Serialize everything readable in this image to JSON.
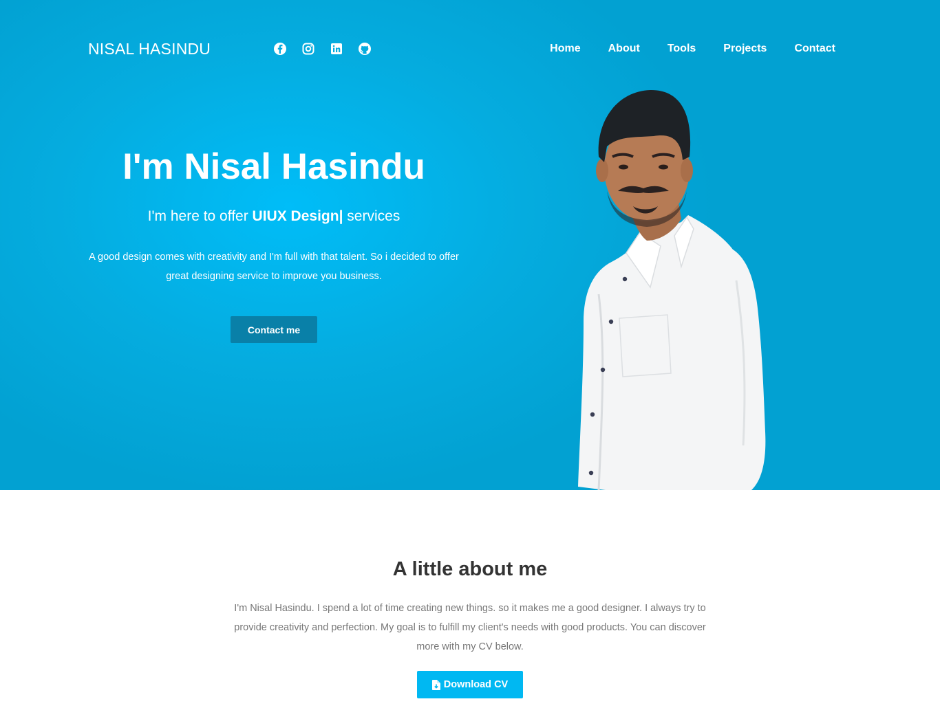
{
  "header": {
    "brand": "NISAL HASINDU",
    "socials": [
      {
        "icon": "facebook-icon"
      },
      {
        "icon": "instagram-icon"
      },
      {
        "icon": "linkedin-icon"
      },
      {
        "icon": "github-icon"
      }
    ],
    "nav": [
      "Home",
      "About",
      "Tools",
      "Projects",
      "Contact"
    ]
  },
  "hero": {
    "title": "I'm Nisal Hasindu",
    "subtitle_prefix": "I'm here to offer",
    "subtitle_highlight": "UIUX Design|",
    "subtitle_suffix": "services",
    "description": "A good design comes with creativity and I'm full with that talent. So i decided to offer great designing service to improve you business.",
    "cta_label": "Contact me"
  },
  "about": {
    "title": "A little about me",
    "text": "I'm Nisal Hasindu. I spend a lot of time creating new things. so it makes me a good designer. I always try to provide creativity and perfection. My goal is to fulfill my client's needs with good products. You can discover more with my CV below.",
    "cv_label": "Download CV"
  },
  "colors": {
    "hero_bg": "#05acdf",
    "contact_button": "#0980a8",
    "cv_button": "#00b8f2",
    "heading_text": "#333333",
    "body_text": "#777777"
  }
}
